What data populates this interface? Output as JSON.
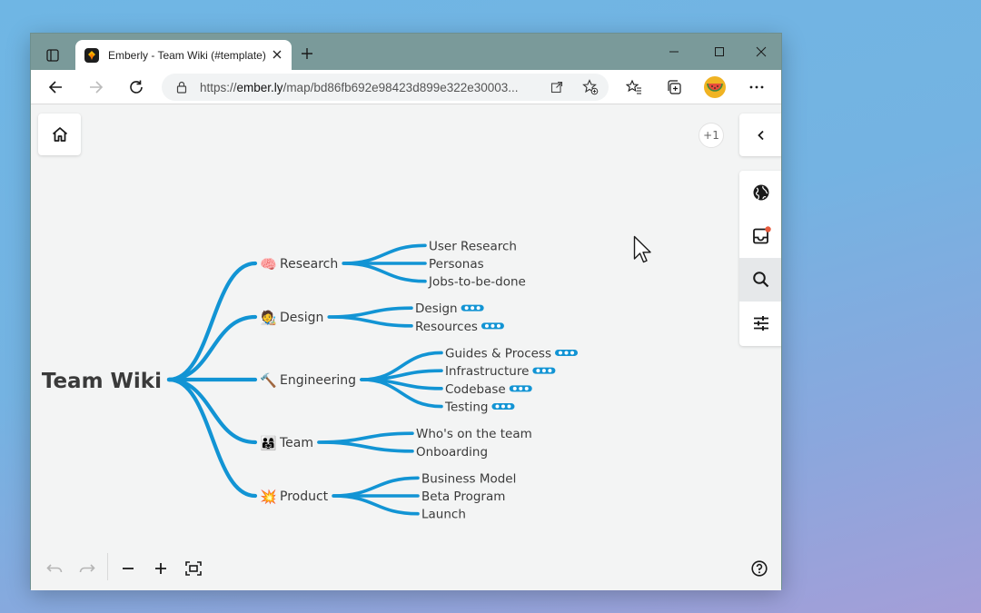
{
  "browser": {
    "tab_title": "Emberly - Team Wiki (#template)",
    "url_prefix": "https://",
    "url_domain": "ember.ly",
    "url_rest": "/map/bd86fb692e98423d899e322e30003..."
  },
  "canvas": {
    "plus_count": "+1"
  },
  "mindmap": {
    "root": "Team Wiki",
    "branches": [
      {
        "label": "Research",
        "icon": "🧠",
        "children": [
          {
            "label": "User Research",
            "more": false
          },
          {
            "label": "Personas",
            "more": false
          },
          {
            "label": "Jobs-to-be-done",
            "more": false
          }
        ]
      },
      {
        "label": "Design",
        "icon": "🧑‍🎨",
        "children": [
          {
            "label": "Design",
            "more": true
          },
          {
            "label": "Resources",
            "more": true
          }
        ]
      },
      {
        "label": "Engineering",
        "icon": "🔨",
        "children": [
          {
            "label": "Guides & Process",
            "more": true
          },
          {
            "label": "Infrastructure",
            "more": true
          },
          {
            "label": "Codebase",
            "more": true
          },
          {
            "label": "Testing",
            "more": true
          }
        ]
      },
      {
        "label": "Team",
        "icon": "👨‍👩‍👧",
        "children": [
          {
            "label": "Who's on the team",
            "more": false
          },
          {
            "label": "Onboarding",
            "more": false
          }
        ]
      },
      {
        "label": "Product",
        "icon": "💥",
        "children": [
          {
            "label": "Business Model",
            "more": false
          },
          {
            "label": "Beta Program",
            "more": false
          },
          {
            "label": "Launch",
            "more": false
          }
        ]
      }
    ]
  },
  "colors": {
    "branch": "#1294d4",
    "titlebar": "#7a9a9a",
    "notification_dot": "#e85a3c"
  }
}
